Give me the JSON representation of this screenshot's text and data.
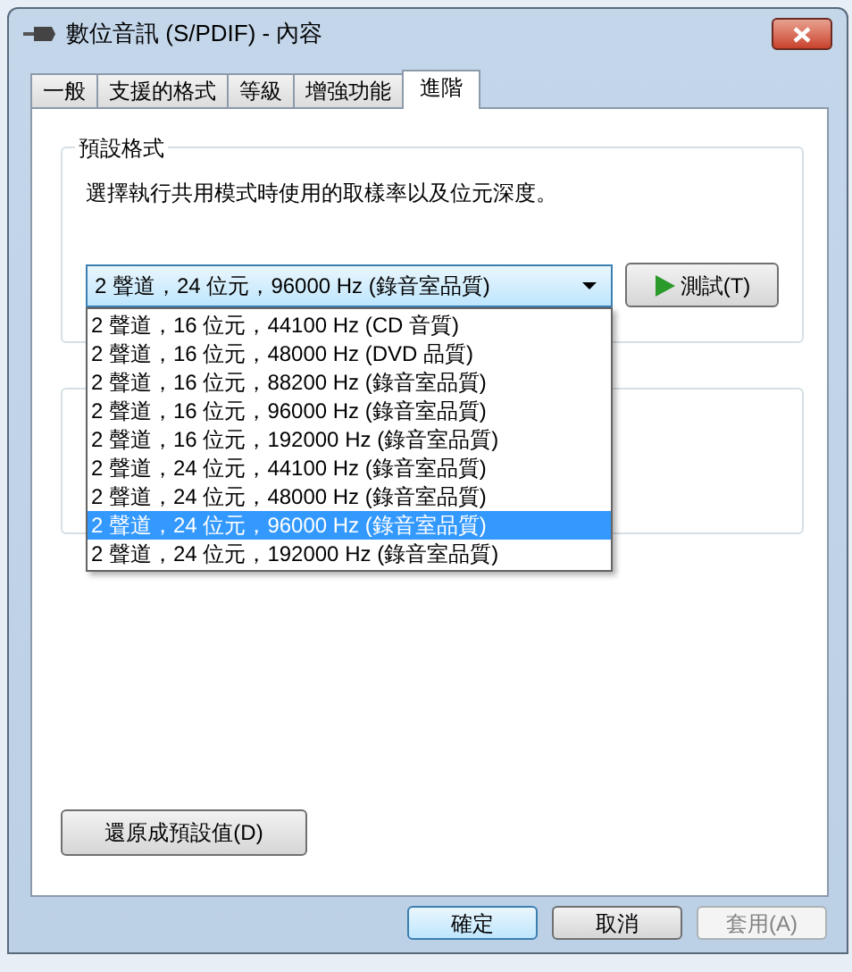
{
  "window": {
    "title": "數位音訊 (S/PDIF) - 內容"
  },
  "tabs": [
    {
      "label": "一般",
      "selected": false
    },
    {
      "label": "支援的格式",
      "selected": false
    },
    {
      "label": "等級",
      "selected": false
    },
    {
      "label": "增強功能",
      "selected": false
    },
    {
      "label": "進階",
      "selected": true
    }
  ],
  "default_format": {
    "group_title": "預設格式",
    "description": "選擇執行共用模式時使用的取樣率以及位元深度。",
    "combo_value": "2 聲道，24 位元，96000 Hz (錄音室品質)",
    "test_button": "測試(T)",
    "options": [
      {
        "label": "2 聲道，16 位元，44100 Hz (CD 音質)",
        "selected": false
      },
      {
        "label": "2 聲道，16 位元，48000 Hz (DVD 品質)",
        "selected": false
      },
      {
        "label": "2 聲道，16 位元，88200 Hz (錄音室品質)",
        "selected": false
      },
      {
        "label": "2 聲道，16 位元，96000 Hz (錄音室品質)",
        "selected": false
      },
      {
        "label": "2 聲道，16 位元，192000 Hz (錄音室品質)",
        "selected": false
      },
      {
        "label": "2 聲道，24 位元，44100 Hz (錄音室品質)",
        "selected": false
      },
      {
        "label": "2 聲道，24 位元，48000 Hz (錄音室品質)",
        "selected": false
      },
      {
        "label": "2 聲道，24 位元，96000 Hz (錄音室品質)",
        "selected": true
      },
      {
        "label": "2 聲道，24 位元，192000 Hz (錄音室品質)",
        "selected": false
      }
    ]
  },
  "restore_button": "還原成預設值(D)",
  "buttons": [
    {
      "label": "確定",
      "disabled": false,
      "selected": true
    },
    {
      "label": "取消",
      "disabled": false,
      "selected": false
    },
    {
      "label": "套用(A)",
      "disabled": true,
      "selected": false
    }
  ]
}
